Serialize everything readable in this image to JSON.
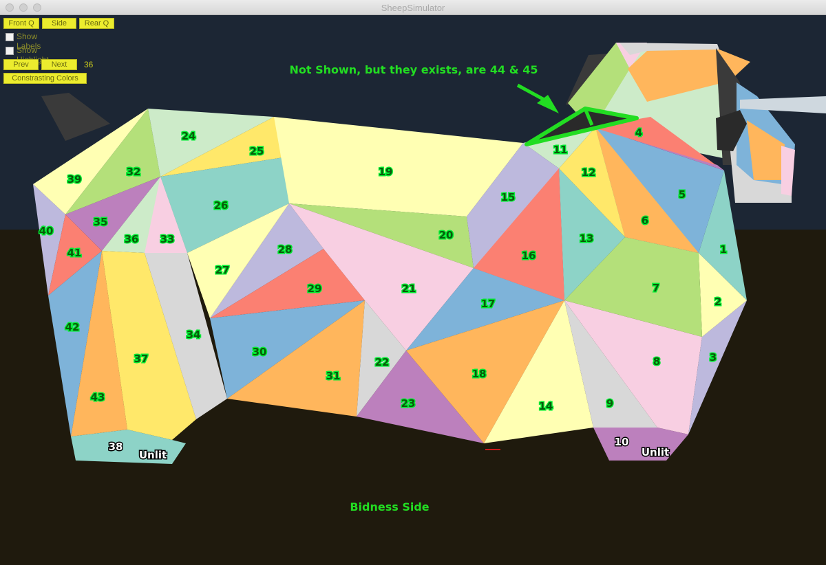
{
  "window": {
    "title": "SheepSimulator"
  },
  "controls": {
    "front_q": "Front Q",
    "side": "Side",
    "rear_q": "Rear Q",
    "show_labels": "Show Labels",
    "show_highlight": "Show Highlight",
    "prev": "Prev",
    "next": "Next",
    "counter": "36",
    "contrasting_colors": "Constrasting Colors"
  },
  "annotations": {
    "not_shown": "Not Shown, but they exists, are 44 & 45",
    "bidness_side": "Bidness Side",
    "unlit": "Unlit"
  },
  "faces": {
    "f1": "1",
    "f2": "2",
    "f3": "3",
    "f4": "4",
    "f5": "5",
    "f6": "6",
    "f7": "7",
    "f8": "8",
    "f9": "9",
    "f10": "10",
    "f11": "11",
    "f12": "12",
    "f13": "13",
    "f14": "14",
    "f15": "15",
    "f16": "16",
    "f17": "17",
    "f18": "18",
    "f19": "19",
    "f20": "20",
    "f21": "21",
    "f22": "22",
    "f23": "23",
    "f24": "24",
    "f25": "25",
    "f26": "26",
    "f27": "27",
    "f28": "28",
    "f29": "29",
    "f30": "30",
    "f31": "31",
    "f32": "32",
    "f33": "33",
    "f34": "34",
    "f35": "35",
    "f36": "36",
    "f37": "37",
    "f38": "38",
    "f39": "39",
    "f40": "40",
    "f41": "41",
    "f42": "42",
    "f43": "43"
  },
  "colors": {
    "sky": "#1c2634",
    "ground": "#1f1a0d",
    "annotation_green": "#22dd22",
    "button_yellow": "#ecec2e"
  }
}
